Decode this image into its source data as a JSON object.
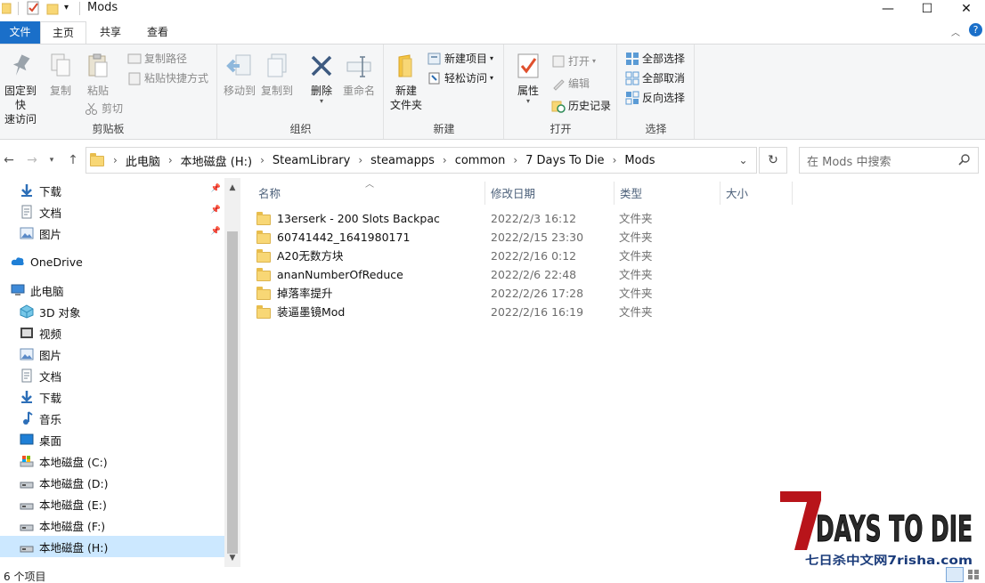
{
  "window": {
    "title": "Mods",
    "controls": {
      "minimize": "—",
      "maximize": "☐",
      "close": "✕"
    }
  },
  "ribbon_tabs": [
    "文件",
    "主页",
    "共享",
    "查看"
  ],
  "ribbon": {
    "clipboard": {
      "label": "剪贴板",
      "pin_quick_access": [
        "固定到快",
        "速访问"
      ],
      "copy": "复制",
      "paste": "粘贴",
      "copy_path": "复制路径",
      "paste_shortcut": "粘贴快捷方式",
      "cut": "剪切"
    },
    "organize": {
      "label": "组织",
      "move_to": "移动到",
      "copy_to": "复制到",
      "delete": "删除",
      "rename": "重命名"
    },
    "new": {
      "label": "新建",
      "new_folder": [
        "新建",
        "文件夹"
      ],
      "new_item": "新建项目",
      "easy_access": "轻松访问"
    },
    "open": {
      "label": "打开",
      "properties": "属性",
      "open": "打开",
      "edit": "编辑",
      "history": "历史记录"
    },
    "select": {
      "label": "选择",
      "select_all": "全部选择",
      "select_none": "全部取消",
      "invert": "反向选择"
    }
  },
  "address": {
    "crumbs": [
      "此电脑",
      "本地磁盘 (H:)",
      "SteamLibrary",
      "steamapps",
      "common",
      "7 Days To Die",
      "Mods"
    ],
    "search_placeholder": "在 Mods 中搜索"
  },
  "nav_pane": [
    {
      "label": "下载",
      "icon": "download-icon",
      "pinned": true
    },
    {
      "label": "文档",
      "icon": "document-icon",
      "pinned": true
    },
    {
      "label": "图片",
      "icon": "pictures-icon",
      "pinned": true
    },
    {
      "label": "OneDrive",
      "icon": "cloud-icon"
    },
    {
      "label": "此电脑",
      "icon": "computer-icon"
    },
    {
      "label": "3D 对象",
      "icon": "3d-objects-icon"
    },
    {
      "label": "视频",
      "icon": "video-icon"
    },
    {
      "label": "图片",
      "icon": "pictures-icon"
    },
    {
      "label": "文档",
      "icon": "document-icon"
    },
    {
      "label": "下载",
      "icon": "download-icon"
    },
    {
      "label": "音乐",
      "icon": "music-icon"
    },
    {
      "label": "桌面",
      "icon": "desktop-icon"
    },
    {
      "label": "本地磁盘 (C:)",
      "icon": "system-drive-icon"
    },
    {
      "label": "本地磁盘 (D:)",
      "icon": "drive-icon"
    },
    {
      "label": "本地磁盘 (E:)",
      "icon": "drive-icon"
    },
    {
      "label": "本地磁盘 (F:)",
      "icon": "drive-icon"
    },
    {
      "label": "本地磁盘 (H:)",
      "icon": "drive-icon",
      "selected": true
    }
  ],
  "columns": [
    "名称",
    "修改日期",
    "类型",
    "大小"
  ],
  "files": [
    {
      "name": "13erserk - 200 Slots Backpac",
      "date": "2022/2/3 16:12",
      "type": "文件夹"
    },
    {
      "name": "60741442_1641980171",
      "date": "2022/2/15 23:30",
      "type": "文件夹"
    },
    {
      "name": "A20无数方块",
      "date": "2022/2/16 0:12",
      "type": "文件夹"
    },
    {
      "name": "ananNumberOfReduce",
      "date": "2022/2/6 22:48",
      "type": "文件夹"
    },
    {
      "name": "掉落率提升",
      "date": "2022/2/26 17:28",
      "type": "文件夹"
    },
    {
      "name": "装逼墨镜Mod",
      "date": "2022/2/16 16:19",
      "type": "文件夹"
    }
  ],
  "status": {
    "item_count": "6 个项目"
  },
  "watermark": {
    "logo_text": "7DAYS TO DIE",
    "site_text": "七日杀中文网7risha.com"
  },
  "colors": {
    "accent": "#1a6fc9",
    "selection": "#cce8ff",
    "folder": "#f8d775"
  }
}
